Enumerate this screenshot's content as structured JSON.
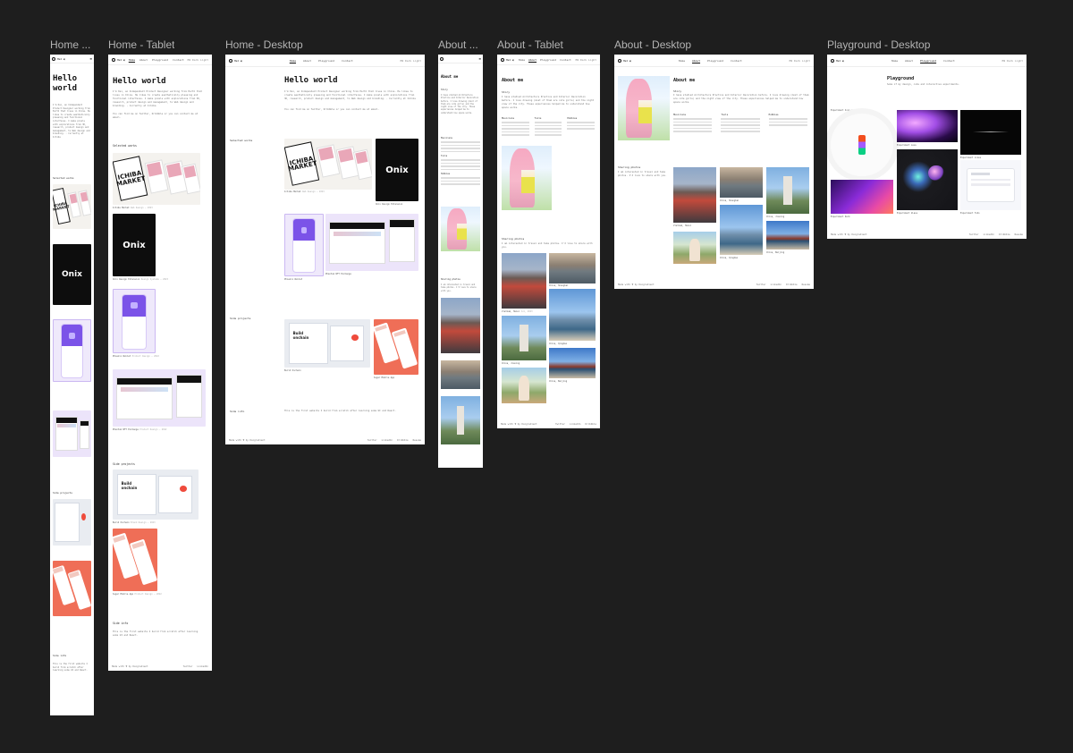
{
  "canvas": {
    "background": "#1e1e1e",
    "label_color": "#b3b3b3"
  },
  "frames": [
    {
      "label": "Home ..."
    },
    {
      "label": "Home - Tablet"
    },
    {
      "label": "Home - Desktop"
    },
    {
      "label": "About ..."
    },
    {
      "label": "About - Tablet"
    },
    {
      "label": "About - Desktop"
    },
    {
      "label": "Playground - Desktop"
    }
  ],
  "site": {
    "logo": "Hel ◐",
    "nav": [
      "Home",
      "About",
      "Playground",
      "Contact"
    ],
    "nav_right": "EN  Dark  Light",
    "home": {
      "title": "Hello world",
      "intro": "I'm Kai, an Independent Product Designer working from Earth that lives in China. He likes to create aesthetically pleasing and functional interfaces. I make pixels with explorations from 3D, research, product design and management, to Web design and branding. - Currently at Ichiba",
      "contact": "You can find me on Twitter, Dribbble or you can contact me at email.",
      "selected_works": "Selected works",
      "side_projects": "Side projects",
      "side_info": "Side info",
      "side_info_text": "This is the first website I build from scratch after learning some UI and React.",
      "works": [
        {
          "title": "Ichiba Market",
          "meta": "Web Design — 2023"
        },
        {
          "title": "Onix Design Extension",
          "meta": "Design Systems — 2023"
        },
        {
          "title": "Phoenix Wallet",
          "meta": "Product Design — 2022"
        },
        {
          "title": "Phantom NFT Exchange",
          "meta": "Product Design — 2022"
        }
      ],
      "projects": [
        {
          "title": "Build Onchain",
          "meta": "Brand Design — 2023"
        },
        {
          "title": "Sugar Mobile App",
          "meta": "Product Design — 2022"
        }
      ],
      "ichiba_word": "ICHIBA MARKET",
      "onix_word": "Onix",
      "build_word": "Build onchain"
    },
    "about": {
      "title": "About me",
      "story": "Story",
      "story_text": "I have studied Architecture Practice and Interior Decoration before. I love drawing (most of them are cute girls) and the night view of the city. These experiences helped me to understand how space works.",
      "columns": [
        {
          "head": "Musicians",
          "items": [
            "Cheese Nightmare",
            "Lost Element",
            "Ai Aoi",
            "Mononoke",
            "Kanade Sakurai"
          ]
        },
        {
          "head": "Tools",
          "items": [
            "Figma",
            "Notion",
            "Framer",
            "Spline",
            "Blender",
            "Cinema 4D"
          ]
        },
        {
          "head": "Hobbies",
          "items": [
            "Cooking",
            "Photograph",
            "Drawing",
            "Gaming"
          ]
        }
      ],
      "sharing": "Sharing photos",
      "sharing_text": "I am interested in travel and take photos. I'd love to share with you.",
      "photos": [
        {
          "caption": "Vietnam, Hanoi",
          "meta": "Jul, 2023"
        },
        {
          "caption": "China, Shanghai",
          "meta": "Jul, 2023"
        },
        {
          "caption": "China, Jiaxing",
          "meta": "Jul, 2023"
        },
        {
          "caption": "China, Shanghai",
          "meta": "Jul, 2023"
        },
        {
          "caption": "China, Qingdao",
          "meta": "Jul, 2023"
        },
        {
          "caption": "China, Beijing",
          "meta": "Jul, 2023"
        }
      ]
    },
    "playground": {
      "title": "Playground",
      "subtitle": "Some of my design, code and interactive experiments.",
      "items": [
        {
          "caption": "Experiment Icon",
          "meta": "Just made"
        },
        {
          "caption": "Experiment Lava",
          "meta": "Just made"
        },
        {
          "caption": "Experiment Lines",
          "meta": "Just made"
        },
        {
          "caption": "Experiment Glass",
          "meta": "Just made"
        },
        {
          "caption": "Experiment Dark",
          "meta": "Just made"
        },
        {
          "caption": "Experiment Todo",
          "meta": "Just made"
        }
      ]
    },
    "footer": {
      "left": "Made with ♥ by Kaigradient",
      "links": [
        "Twitter",
        "LinkedIn",
        "Dribbble",
        "Resume"
      ]
    }
  }
}
